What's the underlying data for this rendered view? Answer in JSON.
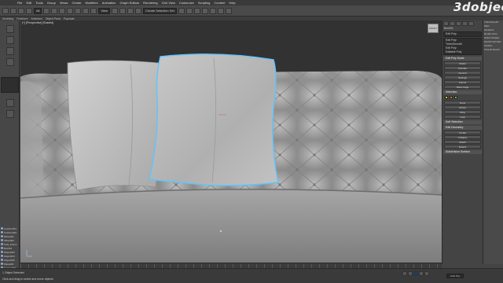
{
  "watermark": "3dobjec",
  "viewport": {
    "label": "[+] [Perspective] [Shaded]",
    "viewcube": "FRONT"
  },
  "right_panel": {
    "object_name": "Box001",
    "modifier": "Edit Poly",
    "list": [
      "Edit Poly",
      "TurboSmooth",
      "Edit Poly",
      "Editable Poly"
    ],
    "headers": [
      "Edit Poly Mode",
      "Selection",
      "Soft Selection",
      "Edit Geometry",
      "Subdivision Surface"
    ],
    "buttons": [
      "Model",
      "Animate",
      "Commit",
      "Settings",
      "Cancel",
      "Show Cage",
      "Grow",
      "Shrink",
      "Ring",
      "Loop",
      "Create",
      "Collapse",
      "Attach",
      "Detach"
    ],
    "swatch_colors": [
      "#d8c23a",
      "#d07a2a",
      "#7cb342"
    ]
  },
  "far_right": {
    "lines": [
      "TurboSmooth",
      "Main",
      "Iterations",
      "Render Iters",
      "Isoline Display",
      "Explicit Normals",
      "Surface",
      "Smooth Result"
    ]
  },
  "scene_list": [
    "Cushion001",
    "Cushion002",
    "Pillow001",
    "Pillow002",
    "Sofa_Frame",
    "Box001",
    "Object003",
    "Object004",
    "Object005",
    "Plane001",
    "Camera001"
  ],
  "status": {
    "line1": "1 Object Selected",
    "line2": "Click and drag to select and move objects"
  },
  "menubar": [
    "File",
    "Edit",
    "Tools",
    "Group",
    "Views",
    "Create",
    "Modifiers",
    "Animation",
    "Graph Editors",
    "Rendering",
    "Civil View",
    "Customize",
    "Scripting",
    "Content",
    "Help"
  ],
  "toolbar": {
    "dropdown1": "All",
    "dropdown2": "View",
    "dropdown3": "Create Selection Set"
  },
  "ribbon": [
    "Modeling",
    "Freeform",
    "Selection",
    "Object Paint",
    "Populate"
  ],
  "autokey": "Auto Key",
  "colors": {
    "selection_outline": "#5ec4ff",
    "viewport_bg": "#323232",
    "play_button": "#1d3d6b"
  }
}
